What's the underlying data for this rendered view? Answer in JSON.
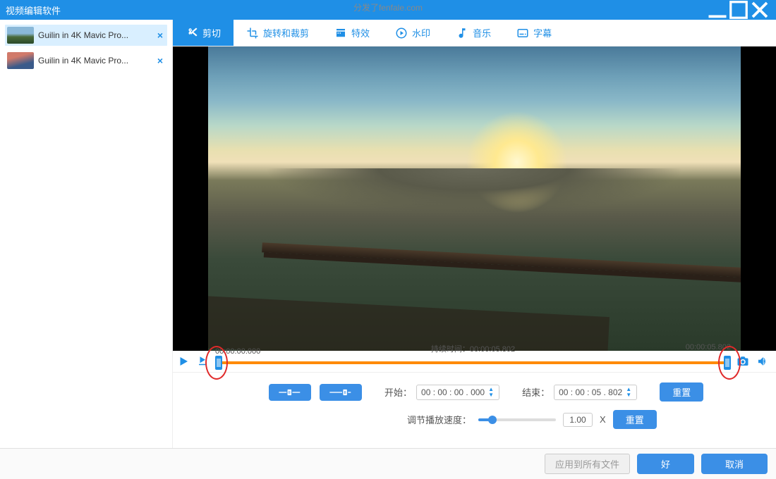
{
  "window": {
    "title": "视频编辑软件"
  },
  "watermark": "分发了fenfale.com",
  "sidebar": {
    "files": [
      {
        "label": "Guilin in 4K Mavic Pro..."
      },
      {
        "label": "Guilin in 4K Mavic Pro..."
      }
    ]
  },
  "tabs": {
    "cut": "剪切",
    "rotate": "旋转和裁剪",
    "effect": "特效",
    "watermark": "水印",
    "music": "音乐",
    "subtitle": "字幕"
  },
  "timeline": {
    "start_time": "00:00:00.000",
    "duration_label": "持续时间：",
    "duration_value": "00:00:05.802",
    "end_time": "00:00:05.802"
  },
  "controls": {
    "start_label": "开始：",
    "start_value": "00 : 00 : 00 . 000",
    "end_label": "结束：",
    "end_value": "00 : 00 : 05 . 802",
    "reset": "重置",
    "speed_label": "调节播放速度：",
    "speed_value": "1.00",
    "speed_unit": "X"
  },
  "footer": {
    "apply_all": "应用到所有文件",
    "ok": "好",
    "cancel": "取消"
  }
}
